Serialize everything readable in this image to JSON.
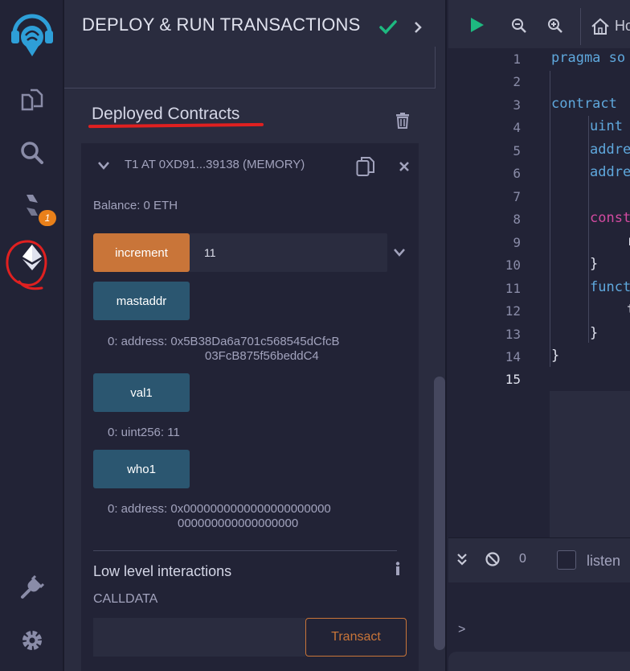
{
  "icons": {
    "remix_logo": "remix-logo-icon",
    "file_explorer": "file-explorer-icon",
    "search": "search-icon",
    "solidity_compiler": "solidity-compiler-icon",
    "deploy_run": "ethereum-deploy-icon",
    "plugin_manager": "plug-icon",
    "settings": "gear-icon"
  },
  "iconbar": {
    "compiler_badge": "1"
  },
  "panel": {
    "title": "DEPLOY & RUN TRANSACTIONS"
  },
  "deployed": {
    "section_title": "Deployed Contracts",
    "contract_name": "T1 AT 0XD91...39138 (MEMORY)",
    "balance": "Balance: 0 ETH",
    "functions": [
      {
        "label": "increment",
        "input_value": "11"
      },
      {
        "label": "mastaddr",
        "result_line1": "0: address: 0x5B38Da6a701c568545dCfcB",
        "result_line2": "03FcB875f56beddC4"
      },
      {
        "label": "val1",
        "result_line1": "0: uint256: 11"
      },
      {
        "label": "who1",
        "result_line1": "0:  address: 0x0000000000000000000000",
        "result_line2": "000000000000000000"
      }
    ],
    "low_level_title": "Low level interactions",
    "calldata_label": "CALLDATA",
    "transact_label": "Transact"
  },
  "editor": {
    "tab_partial": "Ho",
    "line_numbers": [
      "1",
      "2",
      "3",
      "4",
      "5",
      "6",
      "7",
      "8",
      "9",
      "10",
      "11",
      "12",
      "13",
      "14",
      "15"
    ],
    "code": {
      "l1a": "pragma ",
      "l1b": "so",
      "l3": "contract",
      "l4": "uint",
      "l5": "addre",
      "l6": "addre",
      "l8": "const",
      "l9": "r",
      "l10": "}",
      "l11": "funct",
      "l12": "t",
      "l13": "}",
      "l14": "}"
    }
  },
  "terminal": {
    "count": "0",
    "listen_label": "listen",
    "prompt": ">"
  },
  "colors": {
    "accent_orange": "#c97539",
    "function_blue": "#2b5670",
    "success_green": "#1eb980",
    "annotation_red": "#e02020"
  }
}
